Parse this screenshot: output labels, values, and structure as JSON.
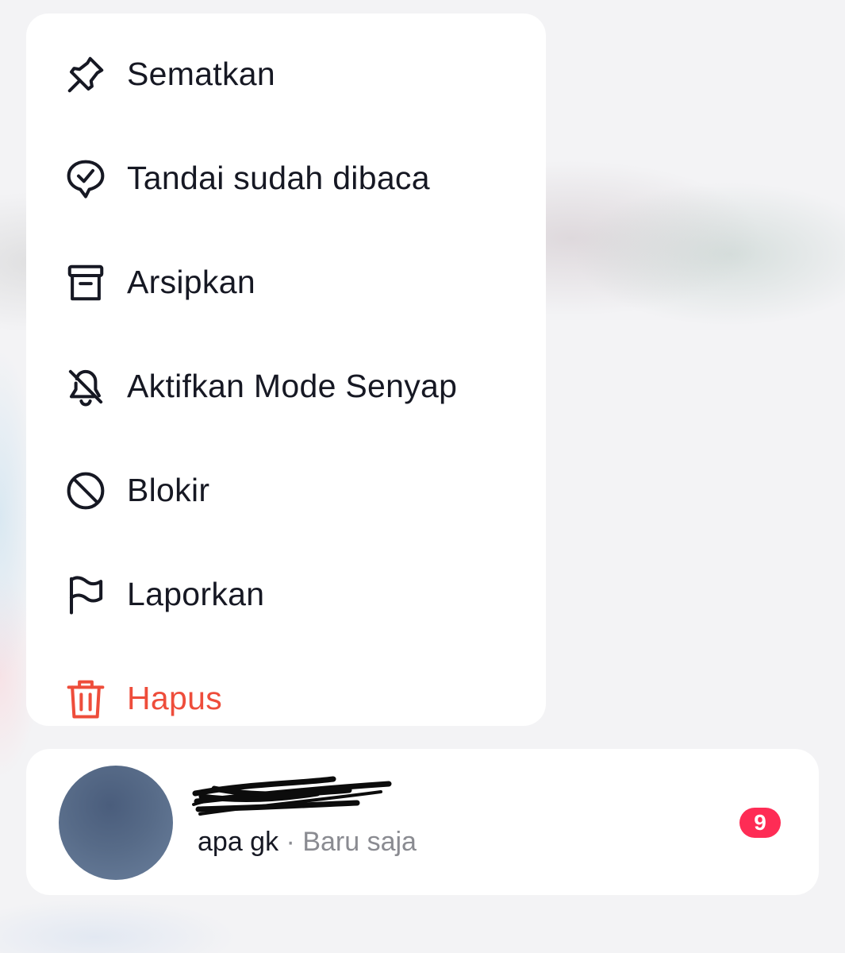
{
  "menu": {
    "items": [
      {
        "label": "Sematkan",
        "icon": "pin-icon"
      },
      {
        "label": "Tandai sudah dibaca",
        "icon": "mark-read-icon"
      },
      {
        "label": "Arsipkan",
        "icon": "archive-icon"
      },
      {
        "label": "Aktifkan Mode Senyap",
        "icon": "mute-bell-icon"
      },
      {
        "label": "Blokir",
        "icon": "block-icon"
      },
      {
        "label": "Laporkan",
        "icon": "flag-icon"
      },
      {
        "label": "Hapus",
        "icon": "trash-icon",
        "color": "#ee4d3b"
      }
    ]
  },
  "chat": {
    "last_message": "apa gk",
    "separator": "·",
    "time": "Baru saja",
    "unread_count": "9",
    "badge_color": "#fe2c55"
  }
}
